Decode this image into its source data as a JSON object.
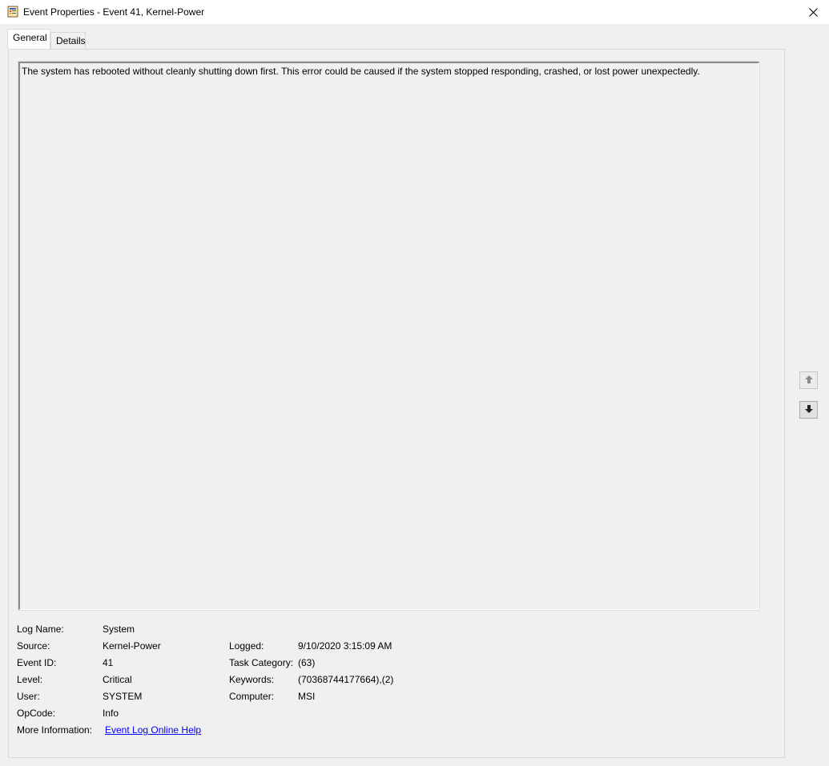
{
  "window": {
    "title": "Event Properties - Event 41, Kernel-Power",
    "icon": "event-viewer-icon"
  },
  "tabs": [
    {
      "label": "General",
      "active": true
    },
    {
      "label": "Details",
      "active": false
    }
  ],
  "description": "The system has rebooted without cleanly shutting down first. This error could be caused if the system stopped responding, crashed, or lost power unexpectedly.",
  "fields": {
    "log_name": {
      "label": "Log Name:",
      "value": "System"
    },
    "source": {
      "label": "Source:",
      "value": "Kernel-Power"
    },
    "event_id": {
      "label": "Event ID:",
      "value": "41"
    },
    "level": {
      "label": "Level:",
      "value": "Critical"
    },
    "user": {
      "label": "User:",
      "value": "SYSTEM"
    },
    "opcode": {
      "label": "OpCode:",
      "value": "Info"
    },
    "more_info": {
      "label": "More Information:",
      "link": "Event Log Online Help"
    },
    "logged": {
      "label": "Logged:",
      "value": "9/10/2020 3:15:09 AM"
    },
    "task_category": {
      "label": "Task Category:",
      "value": "(63)"
    },
    "keywords": {
      "label": "Keywords:",
      "value": "(70368744177664),(2)"
    },
    "computer": {
      "label": "Computer:",
      "value": "MSI"
    }
  },
  "nav": {
    "up_icon": "arrow-up-icon",
    "down_icon": "arrow-down-icon"
  },
  "colors": {
    "link": "#0000ff",
    "background": "#f0f0f0",
    "titlebar": "#ffffff"
  }
}
